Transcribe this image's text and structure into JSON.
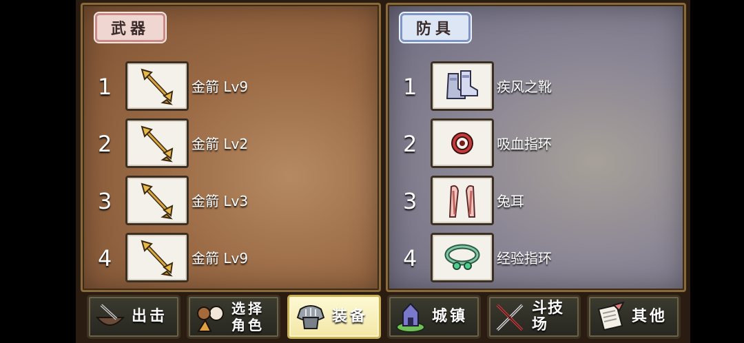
{
  "weapons": {
    "title": "武器",
    "items": [
      {
        "index": "1",
        "name": "金箭 Lv9",
        "icon": "golden-arrow-icon"
      },
      {
        "index": "2",
        "name": "金箭 Lv2",
        "icon": "golden-arrow-icon"
      },
      {
        "index": "3",
        "name": "金箭 Lv3",
        "icon": "golden-arrow-icon"
      },
      {
        "index": "4",
        "name": "金箭 Lv9",
        "icon": "golden-arrow-icon"
      }
    ]
  },
  "armor": {
    "title": "防具",
    "items": [
      {
        "index": "1",
        "name": "疾风之靴",
        "icon": "boots-icon"
      },
      {
        "index": "2",
        "name": "吸血指环",
        "icon": "vampire-ring-icon"
      },
      {
        "index": "3",
        "name": "兔耳",
        "icon": "bunny-ears-icon"
      },
      {
        "index": "4",
        "name": "经验指环",
        "icon": "exp-ring-icon"
      }
    ]
  },
  "nav": [
    {
      "label": "出击",
      "icon": "sortie-icon"
    },
    {
      "label_line1": "选择",
      "label_line2": "角色",
      "icon": "character-select-icon"
    },
    {
      "label": "装备",
      "icon": "equipment-icon",
      "active": true
    },
    {
      "label": "城镇",
      "icon": "town-icon"
    },
    {
      "label": "斗技场",
      "icon": "arena-icon"
    },
    {
      "label": "其他",
      "icon": "other-icon"
    }
  ],
  "colors": {
    "weapons_panel": "#9a6a45",
    "armor_panel": "#8c8795",
    "active_nav": "#f3e7a6"
  }
}
